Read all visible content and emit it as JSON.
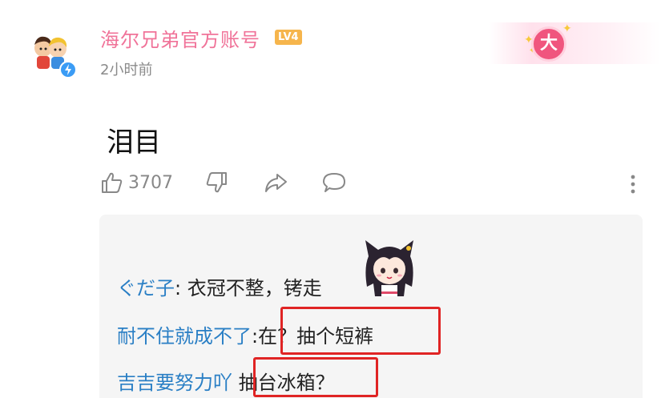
{
  "post": {
    "author": "海尔兄弟官方账号",
    "level": "LV4",
    "time": "2小时前",
    "badge_text": "大",
    "text": "泪目",
    "likes": "3707"
  },
  "replies": [
    {
      "name": "ぐだ子",
      "sep": ":",
      "text": " 衣冠不整，铐走"
    },
    {
      "name": "耐不住就成不了",
      "sep": ":",
      "text": "在？抽个短裤"
    },
    {
      "name": "吉吉要努力吖",
      "sep": "",
      "text": " 抽台冰箱？"
    }
  ],
  "colors": {
    "username": "#f07399",
    "reply_name": "#2a7fc5",
    "highlight": "#e02424",
    "level_badge": "#f6b54c"
  },
  "icons": {
    "like": "thumbs-up-icon",
    "dislike": "thumbs-down-icon",
    "share": "share-icon",
    "comment": "comment-icon",
    "more": "more-vertical-icon",
    "verified": "lightning-verified-icon"
  }
}
